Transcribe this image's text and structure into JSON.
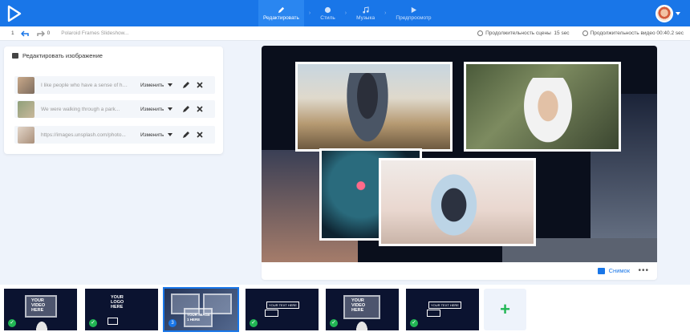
{
  "nav": {
    "steps": [
      {
        "label": "Редактировать",
        "icon": "pencil-icon",
        "active": true
      },
      {
        "label": "Стиль",
        "icon": "palette-icon",
        "active": false
      },
      {
        "label": "Музыка",
        "icon": "music-icon",
        "active": false
      },
      {
        "label": "Предпросмотр",
        "icon": "play-icon",
        "active": false
      }
    ]
  },
  "toolbar": {
    "count": "1",
    "undo_count": "0",
    "title": "Polaroid Frames Slideshow...",
    "scene_duration_label": "Продолжительность сцены",
    "scene_duration": "15 sec",
    "video_duration_label": "Продолжительность видео",
    "video_duration": "00:40.2 sec"
  },
  "panel": {
    "title": "Редактировать изображение",
    "rows": [
      {
        "text": "I like people who have a sense of humor...",
        "action": "Изменить"
      },
      {
        "text": "We were walking through a park...",
        "action": "Изменить"
      },
      {
        "text": "https://images.unsplash.com/photo...",
        "action": "Изменить"
      }
    ]
  },
  "preview": {
    "snapshot_label": "Снимок",
    "more_label": "•••"
  },
  "filmstrip": {
    "slides": [
      {
        "text": "YOUR VIDEO HERE",
        "status": "check"
      },
      {
        "text": "YOUR LOGO HERE",
        "status": "check"
      },
      {
        "text": "YOUR IMAGE 1 HERE",
        "status": "number",
        "number": "3"
      },
      {
        "text": "YOUR TEXT HERE",
        "status": "check"
      },
      {
        "text": "YOUR VIDEO HERE",
        "status": "check"
      },
      {
        "text": "YOUR TEXT HERE",
        "status": "check"
      }
    ],
    "add_label": "+"
  },
  "colors": {
    "accent": "#1976e8",
    "success": "#21b654"
  }
}
